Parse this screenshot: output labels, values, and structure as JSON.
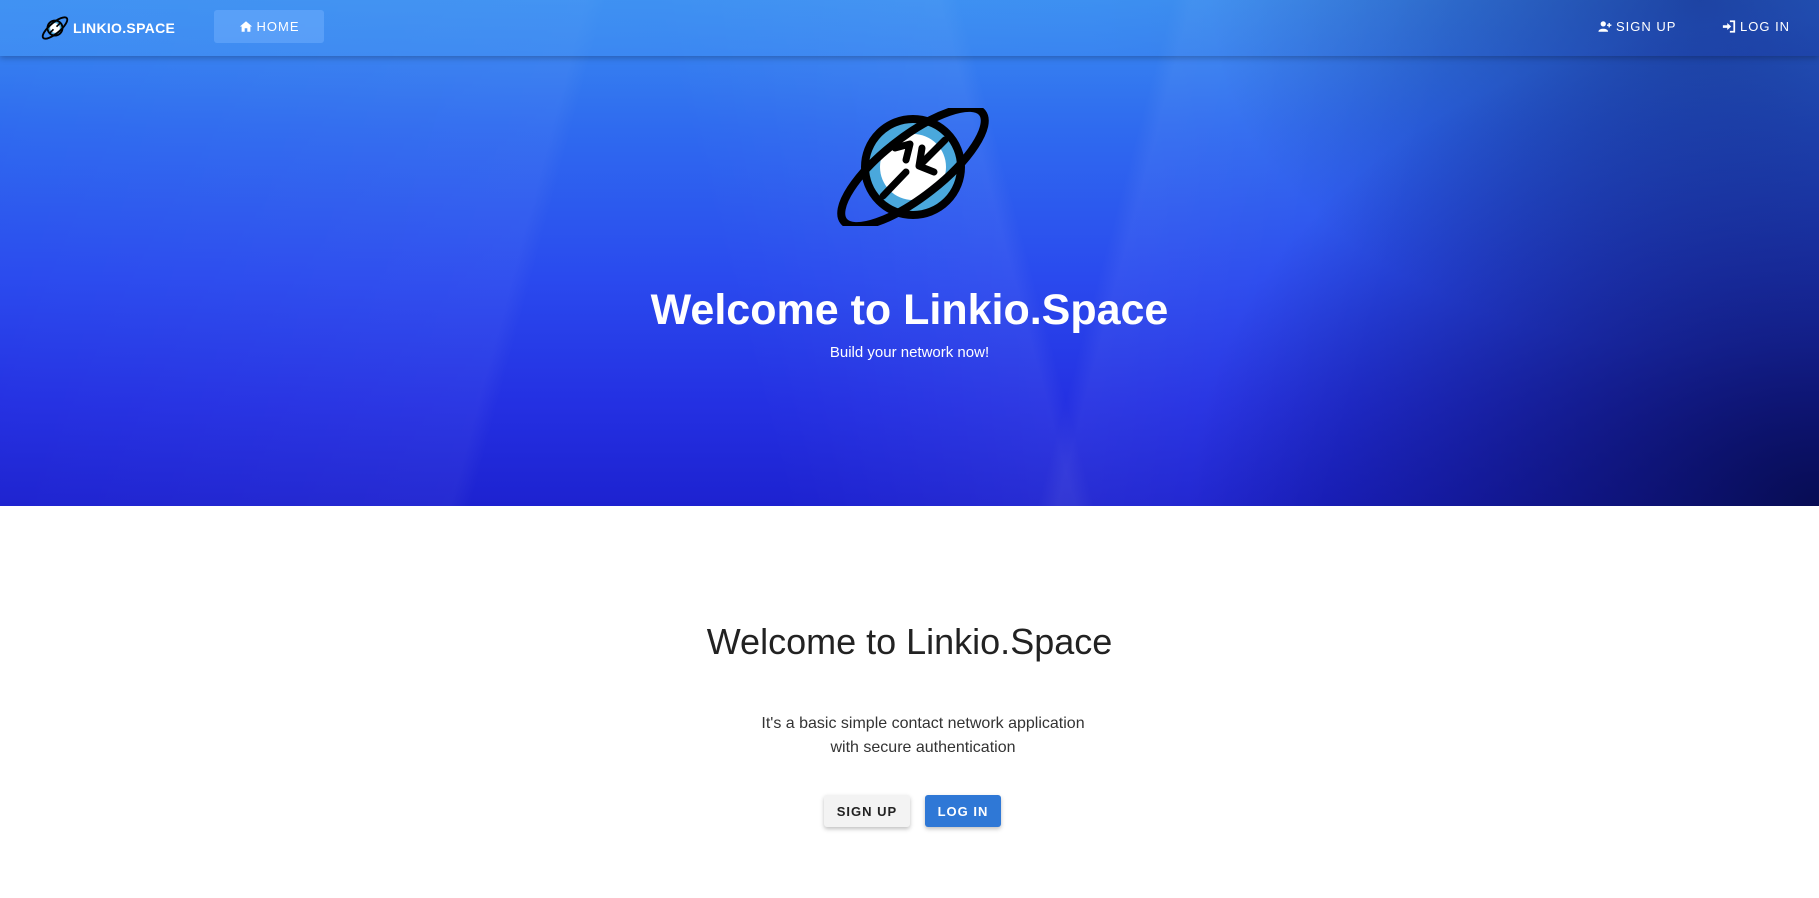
{
  "navbar": {
    "brand": "LINKIO.SPACE",
    "home_label": "HOME",
    "signup_label": "SIGN UP",
    "login_label": "LOG IN"
  },
  "hero": {
    "title": "Welcome to Linkio.Space",
    "subtitle": "Build your network now!"
  },
  "main": {
    "title": "Welcome to Linkio.Space",
    "desc_line1": "It's a basic simple contact network application",
    "desc_line2": "with secure authentication",
    "signup_button": "SIGN UP",
    "login_button": "LOG IN"
  },
  "icons": {
    "brand_logo": "planet-arrows-icon",
    "home": "home-icon",
    "signup": "user-plus-icon",
    "login": "sign-in-icon",
    "hero_logo": "planet-arrows-icon"
  },
  "colors": {
    "hero_top": "#3a8ef0",
    "hero_bottom": "#1d22d0",
    "primary_button": "#2f78d6",
    "planet_fill": "#4aa8dc"
  }
}
